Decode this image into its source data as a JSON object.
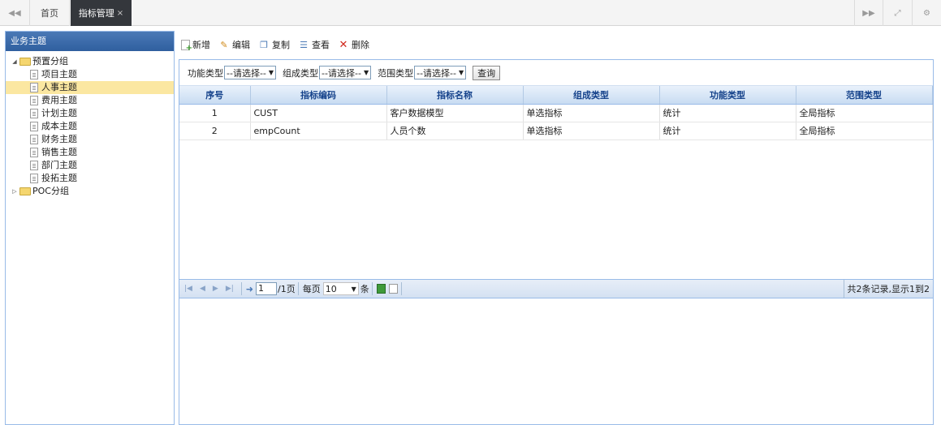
{
  "topbar": {
    "home_tab": "首页",
    "active_tab": "指标管理",
    "close_glyph": "×"
  },
  "sidebar": {
    "title": "业务主题",
    "groups": [
      {
        "label": "预置分组",
        "expanded": true,
        "items": [
          "项目主题",
          "人事主题",
          "费用主题",
          "计划主题",
          "成本主题",
          "财务主题",
          "销售主题",
          "部门主题",
          "投拓主题"
        ]
      },
      {
        "label": "POC分组",
        "expanded": false,
        "items": []
      }
    ],
    "selected_item": "人事主题"
  },
  "toolbar": {
    "new_label": "新增",
    "edit_label": "编辑",
    "copy_label": "复制",
    "view_label": "查看",
    "delete_label": "删除"
  },
  "filter": {
    "func_type_label": "功能类型",
    "func_type_value": "--请选择--",
    "comp_type_label": "组成类型",
    "comp_type_value": "--请选择--",
    "range_type_label": "范围类型",
    "range_type_value": "--请选择--",
    "query_label": "查询"
  },
  "table": {
    "columns": [
      "序号",
      "指标编码",
      "指标名称",
      "组成类型",
      "功能类型",
      "范围类型"
    ],
    "rows": [
      [
        "1",
        "CUST",
        "客户数据模型",
        "单选指标",
        "统计",
        "全局指标"
      ],
      [
        "2",
        "empCount",
        "人员个数",
        "单选指标",
        "统计",
        "全局指标"
      ]
    ]
  },
  "pager": {
    "page_value": "1",
    "total_pages_label": "/1页",
    "per_page_label": "每页",
    "per_page_value": "10",
    "unit_label": "条",
    "info": "共2条记录,显示1到2"
  },
  "colors": {
    "accent": "#2f5f9f",
    "header_text": "#15428b",
    "selected_bg": "#fbe7a1"
  }
}
